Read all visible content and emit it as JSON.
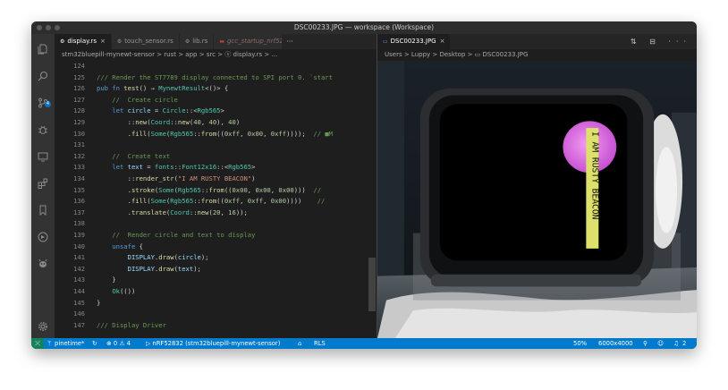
{
  "window": {
    "title": "DSC00233.JPG — workspace (Workspace)"
  },
  "activity_bar": {
    "scm_badge": "4"
  },
  "editor_left": {
    "tabs": [
      {
        "label": "display.rs",
        "icon": "rust-file-icon",
        "close": "×"
      },
      {
        "label": "touch_sensor.rs",
        "icon": "rust-file-icon"
      },
      {
        "label": "lib.rs",
        "icon": "rust-file-icon"
      },
      {
        "label": "gcc_startup_nrf52",
        "icon": "asm-file-icon"
      }
    ],
    "tabs_more": "···",
    "breadcrumb": "stm32bluepill-mynewt-sensor > rust > app > src > ⓢ display.rs > ..."
  },
  "code_lines": [
    {
      "num": "124",
      "segs": []
    },
    {
      "num": "125",
      "segs": [
        {
          "t": "/// Render the ST7789 display connected to SPI port 0. `start",
          "c": "c-cm"
        }
      ]
    },
    {
      "num": "126",
      "segs": [
        {
          "t": "pub fn ",
          "c": "c-kw"
        },
        {
          "t": "test",
          "c": "c-fn"
        },
        {
          "t": "() → ",
          "c": "c-op"
        },
        {
          "t": "MynewtResult",
          "c": "c-ty"
        },
        {
          "t": "<()> {",
          "c": "c-op"
        }
      ]
    },
    {
      "num": "127",
      "segs": [
        {
          "t": "    //  Create circle",
          "c": "c-cm"
        }
      ]
    },
    {
      "num": "128",
      "segs": [
        {
          "t": "    let ",
          "c": "c-kw"
        },
        {
          "t": "circle",
          "c": "c-var"
        },
        {
          "t": " = ",
          "c": "c-op"
        },
        {
          "t": "Circle",
          "c": "c-ty"
        },
        {
          "t": "::<",
          "c": "c-op"
        },
        {
          "t": "Rgb565",
          "c": "c-ty"
        },
        {
          "t": ">",
          "c": "c-op"
        }
      ]
    },
    {
      "num": "129",
      "segs": [
        {
          "t": "        ::",
          "c": "c-op"
        },
        {
          "t": "new",
          "c": "c-fn"
        },
        {
          "t": "(",
          "c": "c-op"
        },
        {
          "t": "Coord",
          "c": "c-ty"
        },
        {
          "t": "::",
          "c": "c-op"
        },
        {
          "t": "new",
          "c": "c-fn"
        },
        {
          "t": "(",
          "c": "c-op"
        },
        {
          "t": "40",
          "c": "c-num"
        },
        {
          "t": ", ",
          "c": "c-op"
        },
        {
          "t": "40",
          "c": "c-num"
        },
        {
          "t": "), ",
          "c": "c-op"
        },
        {
          "t": "40",
          "c": "c-num"
        },
        {
          "t": ")",
          "c": "c-op"
        }
      ]
    },
    {
      "num": "130",
      "segs": [
        {
          "t": "        .",
          "c": "c-op"
        },
        {
          "t": "fill",
          "c": "c-fn"
        },
        {
          "t": "(",
          "c": "c-op"
        },
        {
          "t": "Some",
          "c": "c-ty"
        },
        {
          "t": "(",
          "c": "c-op"
        },
        {
          "t": "Rgb565",
          "c": "c-ty"
        },
        {
          "t": "::",
          "c": "c-op"
        },
        {
          "t": "from",
          "c": "c-fn"
        },
        {
          "t": "((",
          "c": "c-op"
        },
        {
          "t": "0xff",
          "c": "c-num"
        },
        {
          "t": ", ",
          "c": "c-op"
        },
        {
          "t": "0x00",
          "c": "c-num"
        },
        {
          "t": ", ",
          "c": "c-op"
        },
        {
          "t": "0xff",
          "c": "c-num"
        },
        {
          "t": "))));  ",
          "c": "c-op"
        },
        {
          "t": "// ■M",
          "c": "c-cm"
        }
      ]
    },
    {
      "num": "131",
      "segs": []
    },
    {
      "num": "132",
      "segs": [
        {
          "t": "    //  Create text",
          "c": "c-cm"
        }
      ]
    },
    {
      "num": "133",
      "segs": [
        {
          "t": "    let ",
          "c": "c-kw"
        },
        {
          "t": "text",
          "c": "c-var"
        },
        {
          "t": " = ",
          "c": "c-op"
        },
        {
          "t": "fonts",
          "c": "c-ty"
        },
        {
          "t": "::",
          "c": "c-op"
        },
        {
          "t": "Font12x16",
          "c": "c-ty"
        },
        {
          "t": "::<",
          "c": "c-op"
        },
        {
          "t": "Rgb565",
          "c": "c-ty"
        },
        {
          "t": ">",
          "c": "c-op"
        }
      ]
    },
    {
      "num": "134",
      "segs": [
        {
          "t": "        ::",
          "c": "c-op"
        },
        {
          "t": "render_str",
          "c": "c-fn"
        },
        {
          "t": "(",
          "c": "c-op"
        },
        {
          "t": "\"I AM RUSTY BEACON\"",
          "c": "c-str"
        },
        {
          "t": ")",
          "c": "c-op"
        }
      ]
    },
    {
      "num": "135",
      "segs": [
        {
          "t": "        .",
          "c": "c-op"
        },
        {
          "t": "stroke",
          "c": "c-fn"
        },
        {
          "t": "(",
          "c": "c-op"
        },
        {
          "t": "Some",
          "c": "c-ty"
        },
        {
          "t": "(",
          "c": "c-op"
        },
        {
          "t": "Rgb565",
          "c": "c-ty"
        },
        {
          "t": "::",
          "c": "c-op"
        },
        {
          "t": "from",
          "c": "c-fn"
        },
        {
          "t": "((",
          "c": "c-op"
        },
        {
          "t": "0x00",
          "c": "c-num"
        },
        {
          "t": ", ",
          "c": "c-op"
        },
        {
          "t": "0x00",
          "c": "c-num"
        },
        {
          "t": ", ",
          "c": "c-op"
        },
        {
          "t": "0x00",
          "c": "c-num"
        },
        {
          "t": ")))  ",
          "c": "c-op"
        },
        {
          "t": "//",
          "c": "c-cm"
        }
      ]
    },
    {
      "num": "136",
      "segs": [
        {
          "t": "        .",
          "c": "c-op"
        },
        {
          "t": "fill",
          "c": "c-fn"
        },
        {
          "t": "(",
          "c": "c-op"
        },
        {
          "t": "Some",
          "c": "c-ty"
        },
        {
          "t": "(",
          "c": "c-op"
        },
        {
          "t": "Rgb565",
          "c": "c-ty"
        },
        {
          "t": "::",
          "c": "c-op"
        },
        {
          "t": "from",
          "c": "c-fn"
        },
        {
          "t": "((",
          "c": "c-op"
        },
        {
          "t": "0xff",
          "c": "c-num"
        },
        {
          "t": ", ",
          "c": "c-op"
        },
        {
          "t": "0xff",
          "c": "c-num"
        },
        {
          "t": ", ",
          "c": "c-op"
        },
        {
          "t": "0x00",
          "c": "c-num"
        },
        {
          "t": "))))    ",
          "c": "c-op"
        },
        {
          "t": "//",
          "c": "c-cm"
        }
      ]
    },
    {
      "num": "137",
      "segs": [
        {
          "t": "        .",
          "c": "c-op"
        },
        {
          "t": "translate",
          "c": "c-fn"
        },
        {
          "t": "(",
          "c": "c-op"
        },
        {
          "t": "Coord",
          "c": "c-ty"
        },
        {
          "t": "::",
          "c": "c-op"
        },
        {
          "t": "new",
          "c": "c-fn"
        },
        {
          "t": "(",
          "c": "c-op"
        },
        {
          "t": "20",
          "c": "c-num"
        },
        {
          "t": ", ",
          "c": "c-op"
        },
        {
          "t": "16",
          "c": "c-num"
        },
        {
          "t": "));",
          "c": "c-op"
        }
      ]
    },
    {
      "num": "138",
      "segs": []
    },
    {
      "num": "139",
      "segs": [
        {
          "t": "    //  Render circle and text to display",
          "c": "c-cm"
        }
      ]
    },
    {
      "num": "140",
      "segs": [
        {
          "t": "    unsafe",
          "c": "c-kw"
        },
        {
          "t": " {",
          "c": "c-op"
        }
      ]
    },
    {
      "num": "141",
      "segs": [
        {
          "t": "        DISPLAY",
          "c": "c-var"
        },
        {
          "t": ".",
          "c": "c-op"
        },
        {
          "t": "draw",
          "c": "c-fn"
        },
        {
          "t": "(",
          "c": "c-op"
        },
        {
          "t": "circle",
          "c": "c-var"
        },
        {
          "t": ");",
          "c": "c-op"
        }
      ]
    },
    {
      "num": "142",
      "segs": [
        {
          "t": "        DISPLAY",
          "c": "c-var"
        },
        {
          "t": ".",
          "c": "c-op"
        },
        {
          "t": "draw",
          "c": "c-fn"
        },
        {
          "t": "(",
          "c": "c-op"
        },
        {
          "t": "text",
          "c": "c-var"
        },
        {
          "t": ");",
          "c": "c-op"
        }
      ]
    },
    {
      "num": "143",
      "segs": [
        {
          "t": "    }",
          "c": "c-op"
        }
      ]
    },
    {
      "num": "144",
      "segs": [
        {
          "t": "    ",
          "c": "c-op"
        },
        {
          "t": "Ok",
          "c": "c-ty"
        },
        {
          "t": "(())",
          "c": "c-op"
        }
      ]
    },
    {
      "num": "145",
      "segs": [
        {
          "t": "}",
          "c": "c-op"
        }
      ]
    },
    {
      "num": "146",
      "segs": []
    },
    {
      "num": "147",
      "segs": [
        {
          "t": "/// Display Driver",
          "c": "c-cm"
        }
      ]
    }
  ],
  "editor_right": {
    "tab": {
      "label": "DSC00233.JPG",
      "close": "×"
    },
    "actions": "⇅ ⊟ ···",
    "breadcrumb": "Users > Luppy > Desktop > ▭ DSC00233.JPG",
    "screen_text": "I AM RUSTY BEACON"
  },
  "statusbar": {
    "remote": "⤫",
    "branch": "pinetime*",
    "sync": "↻",
    "problems": "⊗ 0 ⚠ 4",
    "target": "▷ nRF52832 (stm32bluepill-mynewt-sensor)",
    "home": "⌂",
    "rls": "RLS",
    "zoom": "50%",
    "size": "6000x4000",
    "bell_count": "2"
  }
}
